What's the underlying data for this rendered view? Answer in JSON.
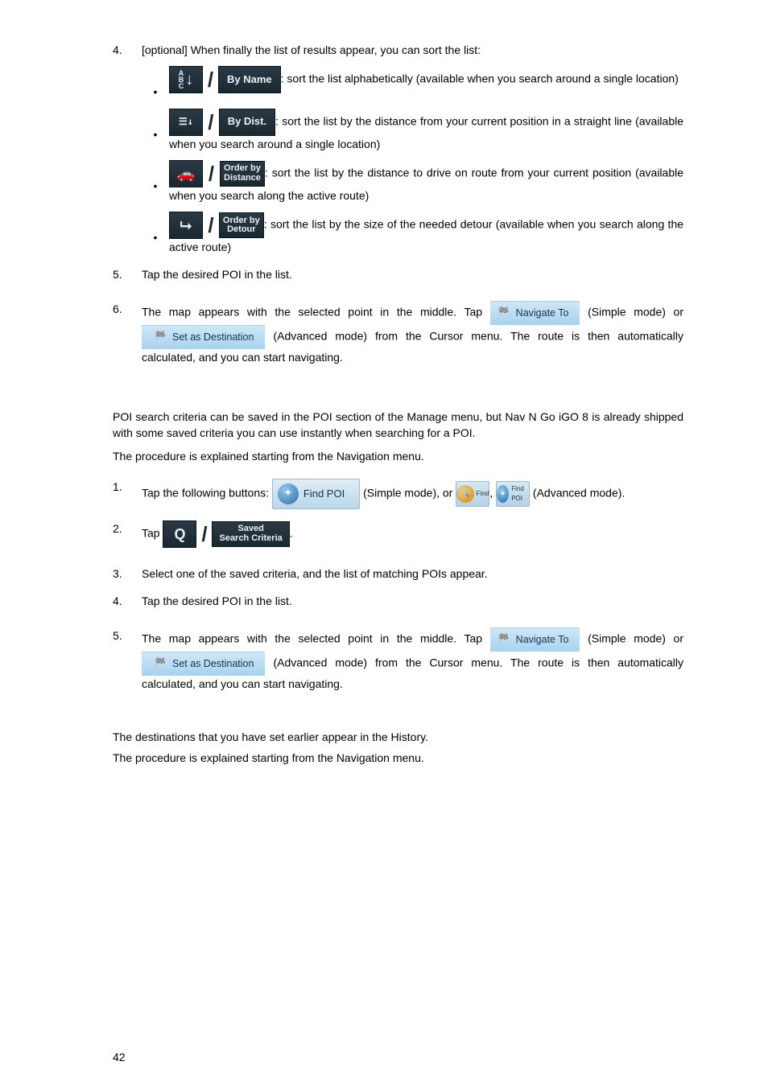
{
  "step4": {
    "num": "4.",
    "text": "[optional] When finally the list of results appear, you can sort the list:",
    "opts": [
      {
        "label": "By Name",
        "desc_a": ": sort the list alphabetically (available when you search around a single location)"
      },
      {
        "label": "By Dist.",
        "desc_a": ": sort the list by the distance from your current position in a straight line (available when you search around a single location)"
      },
      {
        "label_l1": "Order by",
        "label_l2": "Distance",
        "desc_a": ": sort the list by the distance to drive on route from your current position (available when you search along the active route)"
      },
      {
        "label_l1": "Order by",
        "label_l2": "Detour",
        "desc_a": ": sort the list by the size of the needed detour (available when you search along the active route)"
      }
    ]
  },
  "step5": {
    "num": "5.",
    "text": "Tap the desired POI in the list."
  },
  "step6": {
    "num": "6.",
    "text_a": "The map appears with the selected point in the middle. Tap ",
    "text_b": " (Simple mode) or ",
    "text_c": " (Advanced mode) from the Cursor menu. The route is then automatically calculated, and you can start navigating.",
    "nav_to": "Navigate To",
    "set_dest": "Set as Destination"
  },
  "paraA": "POI search criteria can be saved in the POI section of the Manage menu, but Nav N Go iGO 8 is already shipped with some saved criteria you can use instantly when searching for a POI.",
  "paraB": "The procedure is explained starting from the Navigation menu.",
  "b_step1": {
    "num": "1.",
    "text_a": "Tap the following buttons: ",
    "findpoi": "Find POI",
    "text_b": " (Simple mode), or ",
    "find": "Find",
    "findpoi2": "Find POI",
    "text_c": " (Advanced mode)."
  },
  "b_step2": {
    "num": "2.",
    "text_a": "Tap ",
    "saved_l1": "Saved",
    "saved_l2": "Search Criteria",
    "text_b": "."
  },
  "b_step3": {
    "num": "3.",
    "text": "Select one of the saved criteria, and the list of matching POIs appear."
  },
  "b_step4": {
    "num": "4.",
    "text": "Tap the desired POI in the list."
  },
  "b_step5": {
    "num": "5.",
    "text_a": "The map appears with the selected point in the middle. Tap ",
    "text_b": " (Simple mode) or ",
    "text_c": " (Advanced mode) from the Cursor menu. The route is then automatically calculated, and you can start navigating.",
    "nav_to": "Navigate To",
    "set_dest": "Set as Destination"
  },
  "paraC": "The destinations that you have set earlier appear in the History.",
  "paraD": "The procedure is explained starting from the Navigation menu.",
  "page_number": "42"
}
